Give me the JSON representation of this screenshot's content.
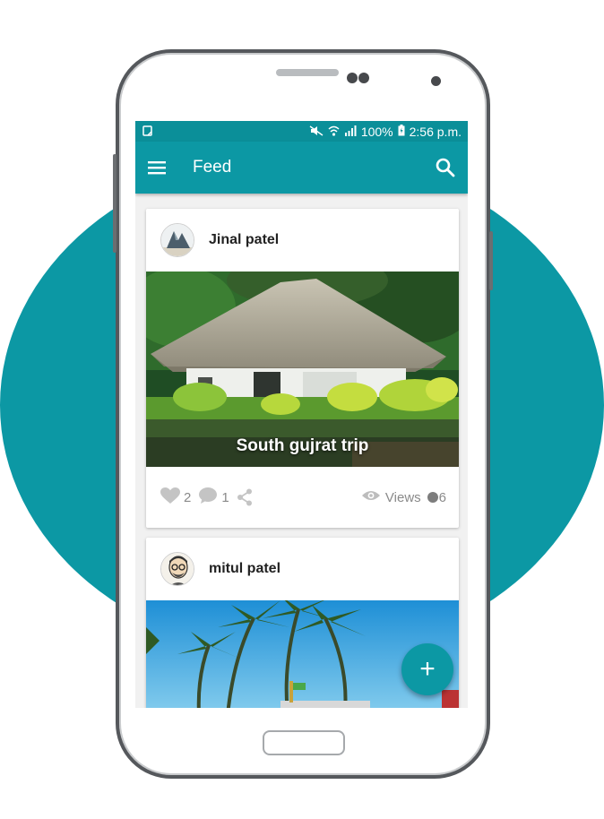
{
  "status_bar": {
    "battery": "100%",
    "time": "2:56 p.m."
  },
  "app_bar": {
    "title": "Feed",
    "menu_icon": "hamburger-menu-icon",
    "search_icon": "search-icon"
  },
  "feed": [
    {
      "author": "Jinal patel",
      "caption": "South gujrat trip",
      "likes": "2",
      "comments": "1",
      "views_label": "Views",
      "views": "6"
    },
    {
      "author": "mitul patel"
    }
  ],
  "fab": {
    "label": "+"
  },
  "colors": {
    "accent": "#0c98a4",
    "status_bar": "#0b8f99"
  }
}
